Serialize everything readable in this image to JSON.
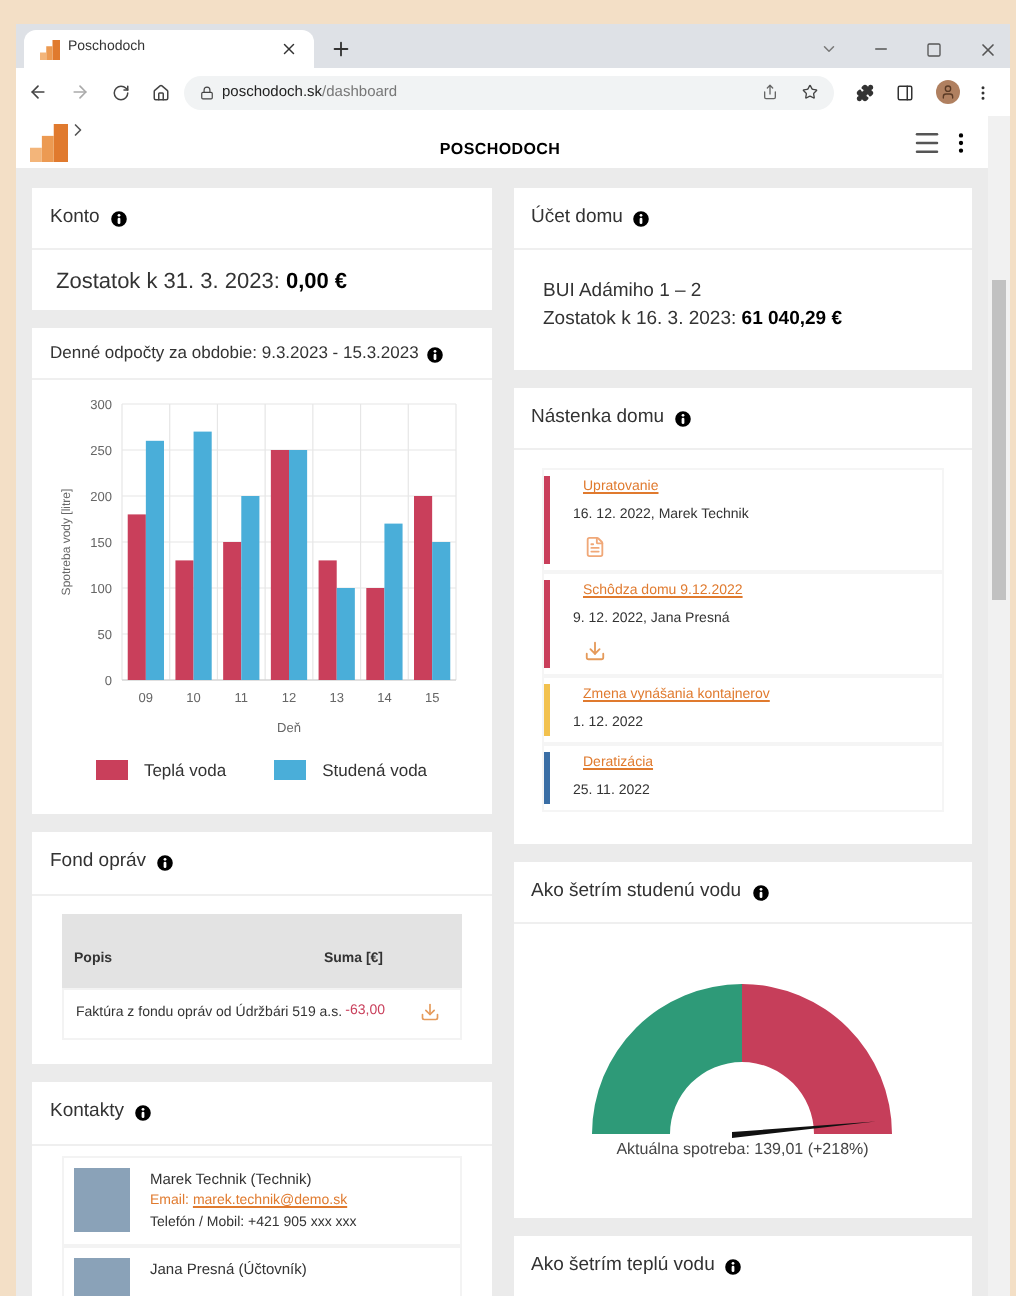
{
  "browser": {
    "tab_title": "Poschodoch",
    "url_host": "poschodoch.sk",
    "url_path": "/dashboard"
  },
  "app": {
    "brand": "POSCHODOCH"
  },
  "konto": {
    "title": "Konto",
    "balance_label": "Zostatok k 31. 3. 2023:",
    "balance_value": "0,00 €"
  },
  "readings": {
    "title": "Denné odpočty za obdobie: 9.3.2023 - 15.3.2023",
    "chart_data": {
      "type": "bar",
      "xlabel": "Deň",
      "ylabel": "Spotreba vody [litre]",
      "categories": [
        "09",
        "10",
        "11",
        "12",
        "13",
        "14",
        "15"
      ],
      "series": [
        {
          "name": "Teplá voda",
          "color": "#c93f5b",
          "values": [
            180,
            130,
            150,
            250,
            130,
            100,
            200
          ]
        },
        {
          "name": "Studená voda",
          "color": "#4aaed9",
          "values": [
            260,
            270,
            200,
            250,
            100,
            170,
            150
          ]
        }
      ],
      "ylim": [
        0,
        300
      ],
      "yticks": [
        0,
        50,
        100,
        150,
        200,
        250,
        300
      ],
      "grid": true,
      "legend": true
    }
  },
  "fund": {
    "title": "Fond opráv",
    "columns": [
      "Popis",
      "Suma [€]"
    ],
    "rows": [
      {
        "description": "Faktúra z fondu opráv od Údržbári 519 a.s.",
        "amount": "-63,00"
      }
    ]
  },
  "contacts": {
    "title": "Kontakty",
    "items": [
      {
        "name": "Marek Technik (Technik)",
        "email_label": "Email:",
        "email": "marek.technik@demo.sk",
        "phone": "Telefón / Mobil: +421 905 xxx xxx"
      },
      {
        "name": "Jana Presná (Účtovník)"
      }
    ]
  },
  "house_account": {
    "title": "Účet domu",
    "address": "BUI Adámiho 1 – 2",
    "balance_label": "Zostatok k 16. 3. 2023:",
    "balance_value": "61 040,29 €"
  },
  "board": {
    "title": "Nástenka domu",
    "items": [
      {
        "title": "Upratovanie",
        "meta": "16. 12. 2022, Marek Technik",
        "color": "#c93f5b",
        "kind": "document"
      },
      {
        "title": "Schôdza domu 9.12.2022",
        "meta": "9. 12. 2022, Jana Presná",
        "color": "#c93f5b",
        "kind": "download"
      },
      {
        "title": "Zmena vynášania kontajnerov",
        "meta": "1. 12. 2022",
        "color": "#f2c14e",
        "kind": "plain"
      },
      {
        "title": "Deratizácia",
        "meta": "25. 11. 2022",
        "color": "#3a6ea5",
        "kind": "plain"
      }
    ]
  },
  "cold_water": {
    "title": "Ako šetrím studenú vodu",
    "level": 0.97,
    "reading": "Aktuálna spotreba: 139,01 (+218%)"
  },
  "hot_water": {
    "title": "Ako šetrím teplú vodu"
  }
}
